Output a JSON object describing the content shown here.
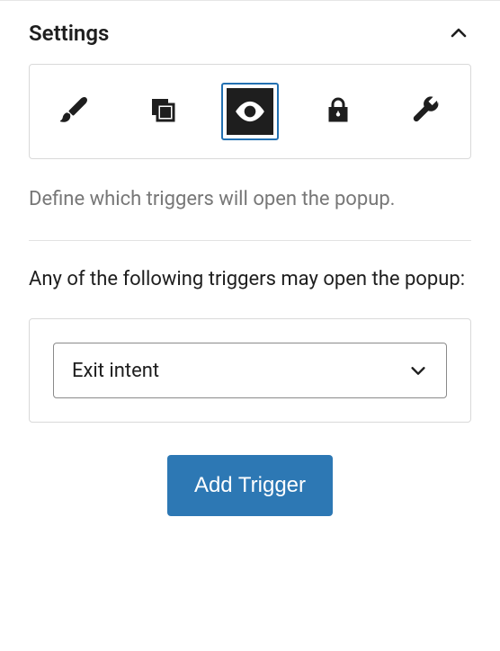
{
  "panel": {
    "title": "Settings",
    "expanded": true
  },
  "tabs": [
    {
      "id": "design",
      "icon": "brush-icon",
      "selected": false
    },
    {
      "id": "layers",
      "icon": "layers-icon",
      "selected": false
    },
    {
      "id": "triggers",
      "icon": "eye-icon",
      "selected": true
    },
    {
      "id": "access",
      "icon": "lock-icon",
      "selected": false
    },
    {
      "id": "tools",
      "icon": "wrench-icon",
      "selected": false
    }
  ],
  "triggers": {
    "description": "Define which triggers will open the popup.",
    "list_label": "Any of the following triggers may open the popup:",
    "items": [
      {
        "value": "exit_intent",
        "label": "Exit intent"
      }
    ],
    "add_button_label": "Add Trigger"
  }
}
